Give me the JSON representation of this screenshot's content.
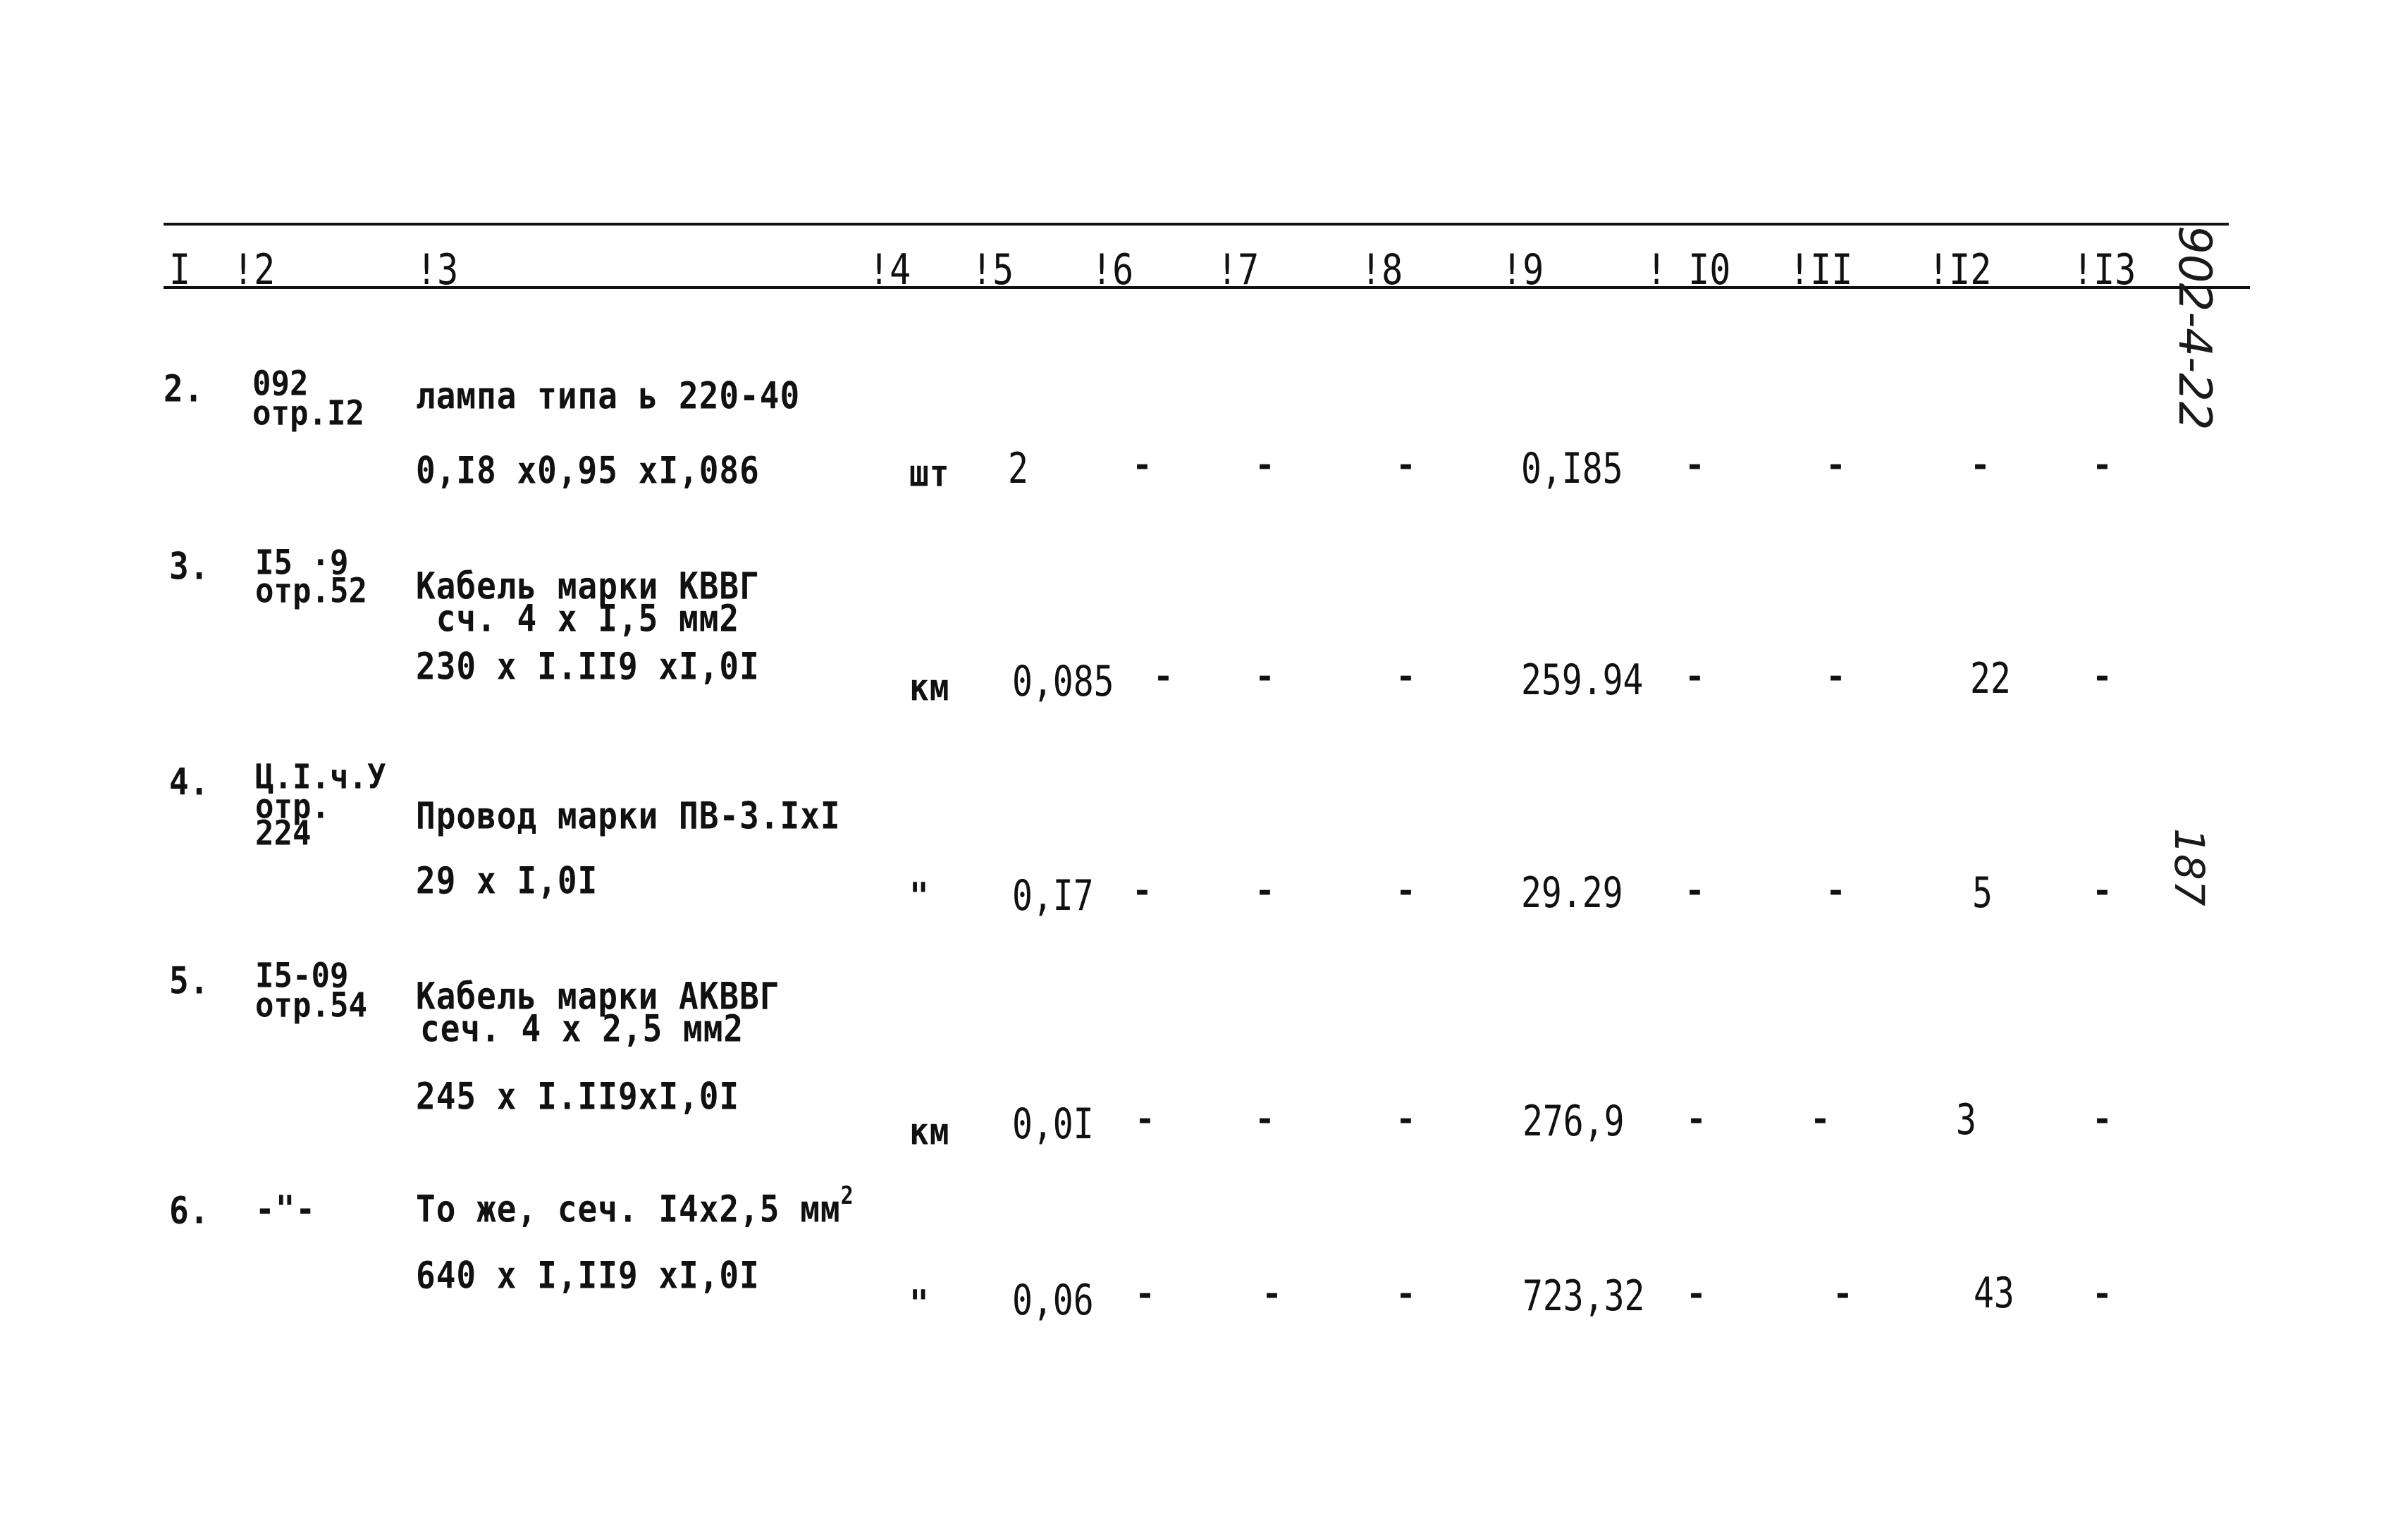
{
  "header": {
    "columns": [
      "I",
      "!2",
      "!3",
      "!4",
      "!5",
      "!6",
      "!7",
      "!8",
      "!9",
      "! I0",
      "!II",
      "!I2",
      "!I3"
    ]
  },
  "annotations": {
    "document_code": "902-4-22",
    "page_number": "187"
  },
  "rows": [
    {
      "no": "2.",
      "ref_line1": "092",
      "ref_line2": "отр.I2",
      "ref_line3": "",
      "name_line1": "лампа типа ь 220-40",
      "name_line2": "",
      "formula": "0,I8 x0,95 xI,086",
      "unit": "шт",
      "qty": "2",
      "c6": "-",
      "c7": "-",
      "c8": "-",
      "c9": "0,I85",
      "c10": "-",
      "c11": "-",
      "c12": "-",
      "c13": "-"
    },
    {
      "no": "3.",
      "ref_line1": "I5 ·9",
      "ref_line2": "отр.52",
      "ref_line3": "",
      "name_line1": "Кабель марки КВВГ",
      "name_line2": " сч. 4 x I,5 мм2",
      "formula": "230 x I.II9 xI,0I",
      "unit": "км",
      "qty": "0,085",
      "c6": "-",
      "c7": "-",
      "c8": "-",
      "c9": "259.94",
      "c10": "-",
      "c11": "-",
      "c12": "22",
      "c13": "-"
    },
    {
      "no": "4.",
      "ref_line1": "Ц.I.ч.У",
      "ref_line2": "отр.",
      "ref_line3": "224",
      "name_line1": "Провод марки ПВ-3.IxI",
      "name_line2": "",
      "formula": "29 x I,0I",
      "unit": "\"",
      "qty": "0,I7",
      "c6": "-",
      "c7": "-",
      "c8": "-",
      "c9": "29.29",
      "c10": "-",
      "c11": "-",
      "c12": "5",
      "c13": "-"
    },
    {
      "no": "5.",
      "ref_line1": "I5-09",
      "ref_line2": "отр.54",
      "ref_line3": "",
      "name_line1": "Кабель марки АКВВГ",
      "name_line2": "сеч. 4 x 2,5 мм2",
      "formula": "245 x I.II9xI,0I",
      "unit": "км",
      "qty": "0,0I",
      "c6": "-",
      "c7": "-",
      "c8": "-",
      "c9": "276,9",
      "c10": "-",
      "c11": "-",
      "c12": "3",
      "c13": "-"
    },
    {
      "no": "6.",
      "ref_line1": "-\"-",
      "ref_line2": "",
      "ref_line3": "",
      "name_line1": "То же, сеч. I4x2,5 мм",
      "name_sup": "2",
      "name_line2": "",
      "formula": "640 x I,II9 xI,0I",
      "unit": "\"",
      "qty": "0,06",
      "c6": "-",
      "c7": "-",
      "c8": "-",
      "c9": "723,32",
      "c10": "-",
      "c11": "-",
      "c12": "43",
      "c13": "-"
    }
  ]
}
